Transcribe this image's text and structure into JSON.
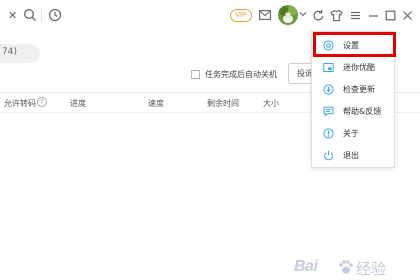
{
  "toolbar": {
    "close_glyph": "✕",
    "vip_label": "VIP"
  },
  "filter": {
    "pill_text": "74)"
  },
  "options": {
    "auto_shutdown_label": "任务完成后自动关机",
    "invest_button_label": "投诉"
  },
  "table": {
    "columns": [
      "允许转码",
      "进度",
      "速度",
      "剩余时间",
      "大小"
    ],
    "help_glyph": "?"
  },
  "menu": {
    "items": [
      {
        "label": "设置",
        "icon": "gear-icon"
      },
      {
        "label": "迷你优酷",
        "icon": "mini-window-icon"
      },
      {
        "label": "检查更新",
        "icon": "update-icon"
      },
      {
        "label": "帮助&反馈",
        "icon": "feedback-icon"
      },
      {
        "label": "关于",
        "icon": "info-icon"
      },
      {
        "label": "退出",
        "icon": "power-icon"
      }
    ]
  },
  "watermark": {
    "brand": "Bai",
    "brand_suffix": "经验"
  },
  "colors": {
    "accent": "#3ca7e8",
    "highlight": "#e10000",
    "vip": "#e6a23c"
  }
}
